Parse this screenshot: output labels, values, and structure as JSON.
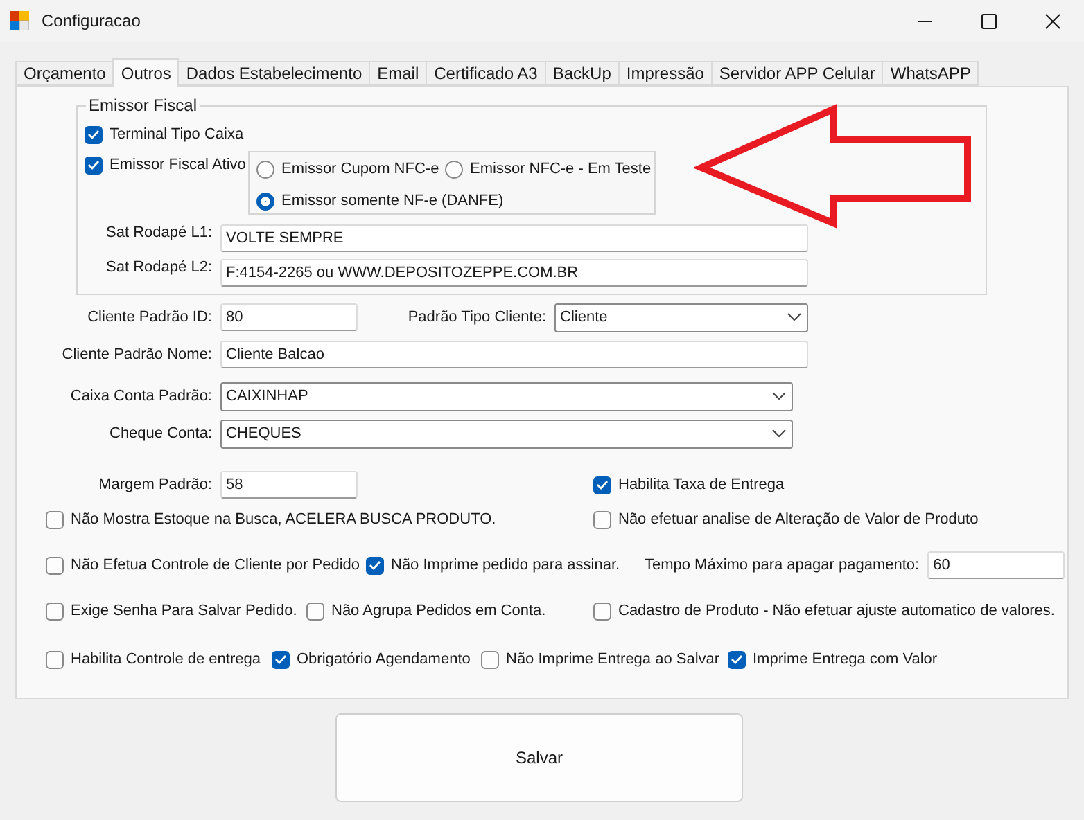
{
  "window": {
    "title": "Configuracao"
  },
  "tabs": [
    {
      "label": "Orçamento",
      "selected": false
    },
    {
      "label": "Outros",
      "selected": true
    },
    {
      "label": "Dados Estabelecimento",
      "selected": false
    },
    {
      "label": "Email",
      "selected": false
    },
    {
      "label": "Certificado A3",
      "selected": false
    },
    {
      "label": "BackUp",
      "selected": false
    },
    {
      "label": "Impressão",
      "selected": false
    },
    {
      "label": "Servidor APP Celular",
      "selected": false
    },
    {
      "label": "WhatsAPP",
      "selected": false
    }
  ],
  "emissor_fiscal": {
    "title": "Emissor Fiscal",
    "checkboxes": [
      {
        "label": "Terminal Tipo Caixa",
        "checked": true
      },
      {
        "label": "Emissor Fiscal Ativo",
        "checked": true
      }
    ],
    "radios": [
      {
        "label": "Emissor Cupom NFC-e",
        "selected": false
      },
      {
        "label": "Emissor NFC-e - Em Teste",
        "selected": false
      },
      {
        "label": "Emissor somente NF-e (DANFE)",
        "selected": true
      }
    ],
    "fields": [
      {
        "label": "Sat Rodapé L1:",
        "value": "VOLTE SEMPRE"
      },
      {
        "label": "Sat Rodapé L2:",
        "value": "F:4154-2265 ou WWW.DEPOSITOZEPPE.COM.BR"
      }
    ]
  },
  "rows": [
    [
      {
        "kind": "field",
        "label": "Cliente Padrão ID:",
        "value": "80"
      },
      {
        "kind": "combo",
        "label": "Padrão Tipo Cliente:",
        "value": "Cliente"
      }
    ],
    [
      {
        "kind": "field",
        "label": "Cliente Padrão Nome:",
        "value": "Cliente Balcao"
      }
    ],
    [
      {
        "kind": "combo",
        "label": "Caixa Conta Padrão:",
        "value": "CAIXINHAP"
      }
    ],
    [
      {
        "kind": "combo",
        "label": "Cheque Conta:",
        "value": "CHEQUES"
      }
    ],
    [
      {
        "kind": "field",
        "label": "Margem Padrão:",
        "value": "58"
      },
      {
        "kind": "checkbox",
        "label": "Habilita Taxa de Entrega",
        "checked": true
      }
    ],
    [
      {
        "kind": "checkbox",
        "label": "Não Mostra Estoque na Busca, ACELERA BUSCA PRODUTO.",
        "checked": false
      },
      {
        "kind": "checkbox",
        "label": "Não efetuar analise de Alteração de Valor de Produto",
        "checked": false
      }
    ],
    [
      {
        "kind": "checkbox",
        "label": "Não Efetua Controle de Cliente por Pedido",
        "checked": false
      },
      {
        "kind": "checkbox",
        "label": "Não Imprime pedido para assinar.",
        "checked": true
      },
      {
        "kind": "field",
        "label": "Tempo Máximo para apagar pagamento:",
        "value": "60"
      }
    ],
    [
      {
        "kind": "checkbox",
        "label": "Exige Senha Para Salvar Pedido.",
        "checked": false
      },
      {
        "kind": "checkbox",
        "label": "Não Agrupa Pedidos em Conta.",
        "checked": false
      },
      {
        "kind": "checkbox",
        "label": "Cadastro de Produto - Não efetuar ajuste automatico de valores.",
        "checked": false
      }
    ],
    [
      {
        "kind": "checkbox",
        "label": "Habilita Controle de entrega",
        "checked": false
      },
      {
        "kind": "checkbox",
        "label": "Obrigatório Agendamento",
        "checked": true
      },
      {
        "kind": "checkbox",
        "label": "Não Imprime Entrega ao Salvar",
        "checked": false
      },
      {
        "kind": "checkbox",
        "label": "Imprime Entrega com Valor",
        "checked": true
      }
    ]
  ],
  "save_button": {
    "label": "Salvar"
  }
}
